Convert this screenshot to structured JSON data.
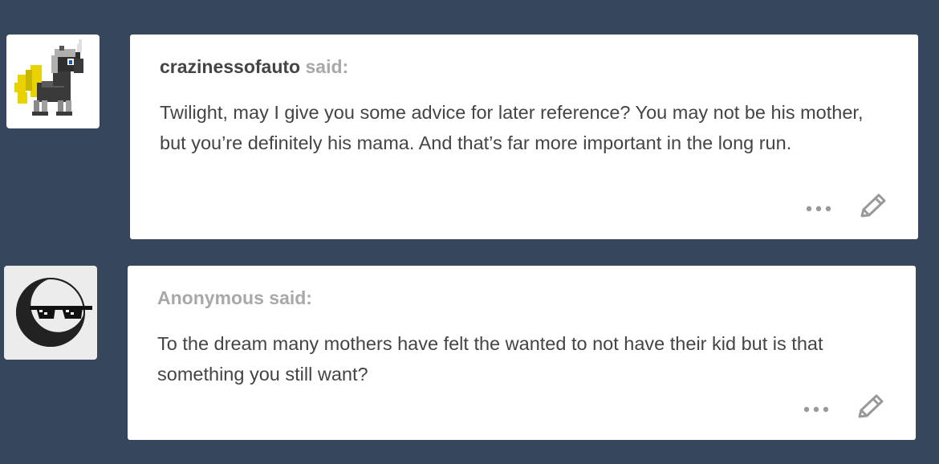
{
  "posts": [
    {
      "asker_name": "crazinessofauto",
      "said_label": "said:",
      "avatar_icon": "pixel-pony-avatar-icon",
      "message": "Twilight, may I give you some advice for later reference? You may not be his mother, but you’re definitely his mama. And that’s far more important in the long run.",
      "controls": {
        "more_icon": "ellipsis-icon",
        "edit_icon": "pencil-icon"
      }
    },
    {
      "asker_name": "Anonymous",
      "said_label": "said:",
      "avatar_icon": "sunglasses-moon-avatar-icon",
      "message": "To the dream many mothers have felt the wanted to not have their kid but is that something you still want?",
      "controls": {
        "more_icon": "ellipsis-icon",
        "edit_icon": "pencil-icon"
      }
    }
  ],
  "colors": {
    "background": "#36465d",
    "card": "#ffffff",
    "text": "#444444",
    "muted": "#a8a8a8",
    "icon": "#999999"
  }
}
